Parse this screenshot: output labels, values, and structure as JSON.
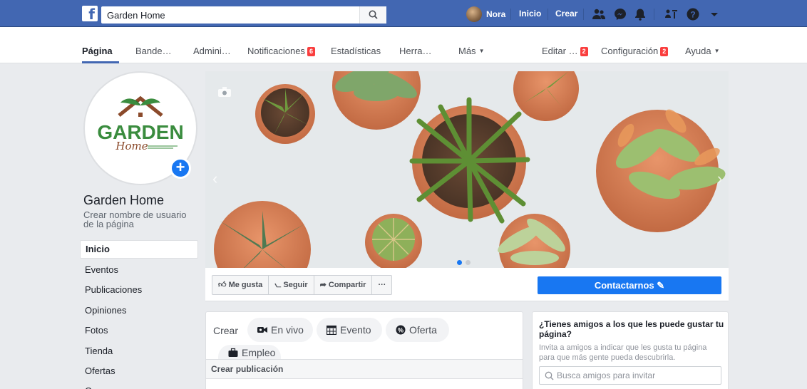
{
  "topbar": {
    "logo": "f",
    "search_value": "Garden Home",
    "user_name": "Nora",
    "links": [
      "Inicio",
      "Crear"
    ]
  },
  "page_nav": {
    "items": [
      {
        "label": "Página",
        "active": true
      },
      {
        "label": "Bande…"
      },
      {
        "label": "Admini…"
      },
      {
        "label": "Notificaciones",
        "badge": "6"
      },
      {
        "label": "Estadísticas"
      },
      {
        "label": "Herra…"
      },
      {
        "label": "Más"
      },
      {
        "label": "Editar …",
        "badge": "2"
      },
      {
        "label": "Configuración",
        "badge": "2"
      },
      {
        "label": "Ayuda"
      }
    ]
  },
  "profile": {
    "logo_text": "GARDEN",
    "logo_script": "Home",
    "name": "Garden Home",
    "username_prompt": "Crear nombre de usuario de la página"
  },
  "left_menu": [
    "Inicio",
    "Eventos",
    "Publicaciones",
    "Opiniones",
    "Fotos",
    "Tienda",
    "Ofertas",
    "Grupos"
  ],
  "actions": {
    "like": "Me gusta",
    "follow": "Seguir",
    "share": "Compartir",
    "more": "···",
    "contact": "Contactarnos"
  },
  "create": {
    "label": "Crear",
    "live": "En vivo",
    "event": "Evento",
    "offer": "Oferta",
    "job": "Empleo",
    "post_header": "Crear publicación"
  },
  "invite": {
    "title": "¿Tienes amigos a los que les puede gustar tu página?",
    "text": "Invita a amigos a indicar que les gusta tu página para que más gente pueda descubrirla.",
    "search_placeholder": "Busca amigos para invitar"
  },
  "colors": {
    "brand_blue": "#4267b2",
    "button_blue": "#1877f2",
    "badge_red": "#fa3e3e"
  }
}
